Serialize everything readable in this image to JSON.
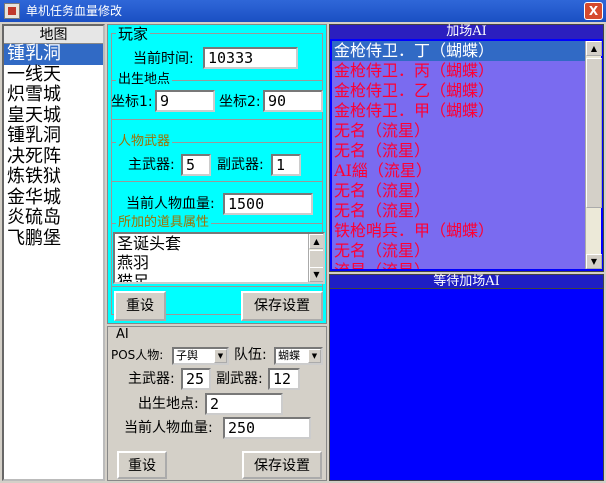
{
  "window": {
    "title": "单机任务血量修改",
    "close_label": "X"
  },
  "map_list": {
    "header": "地图",
    "items": [
      "锺乳洞",
      "一线天",
      "炽雪城",
      "皇天城",
      "锺乳洞",
      "决死阵",
      "炼铁狱",
      "金华城",
      "炎硫岛",
      "飞鹏堡"
    ],
    "selected_index": 0
  },
  "player": {
    "legend": "玩家",
    "current_time_label": "当前时间:",
    "current_time_value": "10333",
    "spawn_legend": "出生地点",
    "coord1_label": "坐标1:",
    "coord1_value": "9",
    "coord2_label": "坐标2:",
    "coord2_value": "90",
    "weapon_legend": "人物武器",
    "main_weapon_label": "主武器:",
    "main_weapon_value": "5",
    "sub_weapon_label": "副武器:",
    "sub_weapon_value": "1",
    "hp_label": "当前人物血量:",
    "hp_value": "1500",
    "props_legend": "所加的道具属性",
    "props": [
      "圣诞头套",
      "燕羽",
      "猫足"
    ],
    "reset_label": "重设",
    "save_label": "保存设置"
  },
  "ai": {
    "legend": "AI",
    "pos_label": "POS人物:",
    "pos_value": "子舆",
    "team_label": "队伍:",
    "team_value": "蝴蝶",
    "main_weapon_label": "主武器:",
    "main_weapon_value": "25",
    "sub_weapon_label": "副武器:",
    "sub_weapon_value": "12",
    "spawn_label": "出生地点:",
    "spawn_value": "2",
    "hp_label": "当前人物血量:",
    "hp_value": "250",
    "reset_label": "重设",
    "save_label": "保存设置"
  },
  "join_ai": {
    "header": "加场AI",
    "items": [
      "金枪侍卫．丁（蝴蝶）",
      "金枪侍卫．丙（蝴蝶）",
      "金枪侍卫．乙（蝴蝶）",
      "金枪侍卫．甲（蝴蝶）",
      "无名（流星）",
      "无名（流星）",
      "AI緇（流星）",
      "无名（流星）",
      "无名（流星）",
      "铁枪哨兵．甲（蝴蝶）",
      "无名（流星）",
      "流星（流星）"
    ],
    "selected_index": 0
  },
  "waiting_ai": {
    "header": "等待加场AI"
  },
  "colors": {
    "player_bg": "#00ffff",
    "join_list_bg": "#7a6bf0",
    "ai_item_text": "#ff0033",
    "selection": "#316ac5",
    "waiting_bg": "#0000ff"
  }
}
